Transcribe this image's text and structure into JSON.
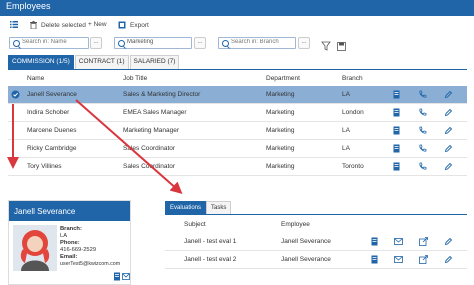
{
  "app": {
    "title": "Employees"
  },
  "toolbar": {
    "delete_label": "Delete selected",
    "new_label": "+ New",
    "export_label": "Export"
  },
  "filters": {
    "name_placeholder": "Search in: Name",
    "department_value": "Marketing",
    "branch_placeholder": "Search in: Branch",
    "more_label": "..."
  },
  "tabs": [
    {
      "label": "COMMISSION (1/5)",
      "active": true
    },
    {
      "label": "CONTRACT (1)",
      "active": false
    },
    {
      "label": "SALARIED (7)",
      "active": false
    }
  ],
  "grid": {
    "columns": [
      "Name",
      "Job Title",
      "Department",
      "Branch"
    ],
    "rows": [
      {
        "name": "Janell Severance",
        "title": "Sales & Marketing Director",
        "department": "Marketing",
        "branch": "LA",
        "selected": true
      },
      {
        "name": "Indira Schober",
        "title": "EMEA Sales Manager",
        "department": "Marketing",
        "branch": "London",
        "selected": false
      },
      {
        "name": "Marcene Duenes",
        "title": "Marketing Manager",
        "department": "Marketing",
        "branch": "LA",
        "selected": false
      },
      {
        "name": "Ricky Cambridge",
        "title": "Sales Coordinator",
        "department": "Marketing",
        "branch": "LA",
        "selected": false
      },
      {
        "name": "Tory Villines",
        "title": "Sales Coordinator",
        "department": "Marketing",
        "branch": "Toronto",
        "selected": false
      }
    ]
  },
  "card": {
    "name": "Janell Severance",
    "branch_label": "Branch:",
    "branch_value": "LA",
    "phone_label": "Phone:",
    "phone_value": "416-669-2529",
    "email_label": "Email:",
    "email_value": "userTest5@kwizcom.com"
  },
  "detail_tabs": [
    {
      "label": "Evaluations",
      "active": true
    },
    {
      "label": "Tasks",
      "active": false
    }
  ],
  "detail_grid": {
    "columns": [
      "Subject",
      "Employee"
    ],
    "rows": [
      {
        "subject": "Janell - test eval 1",
        "employee": "Janell Severance"
      },
      {
        "subject": "Janell - test eval 2",
        "employee": "Janell Severance"
      }
    ]
  },
  "colors": {
    "accent": "#1f65a8",
    "selected_row": "#8aaed4",
    "arrow": "#d9363e"
  },
  "icons": [
    "list-icon",
    "trash-icon",
    "export-icon",
    "search-icon",
    "filter-icon",
    "save-icon",
    "check-circle-icon",
    "document-icon",
    "phone-icon",
    "edit-icon",
    "mail-icon",
    "open-icon"
  ]
}
